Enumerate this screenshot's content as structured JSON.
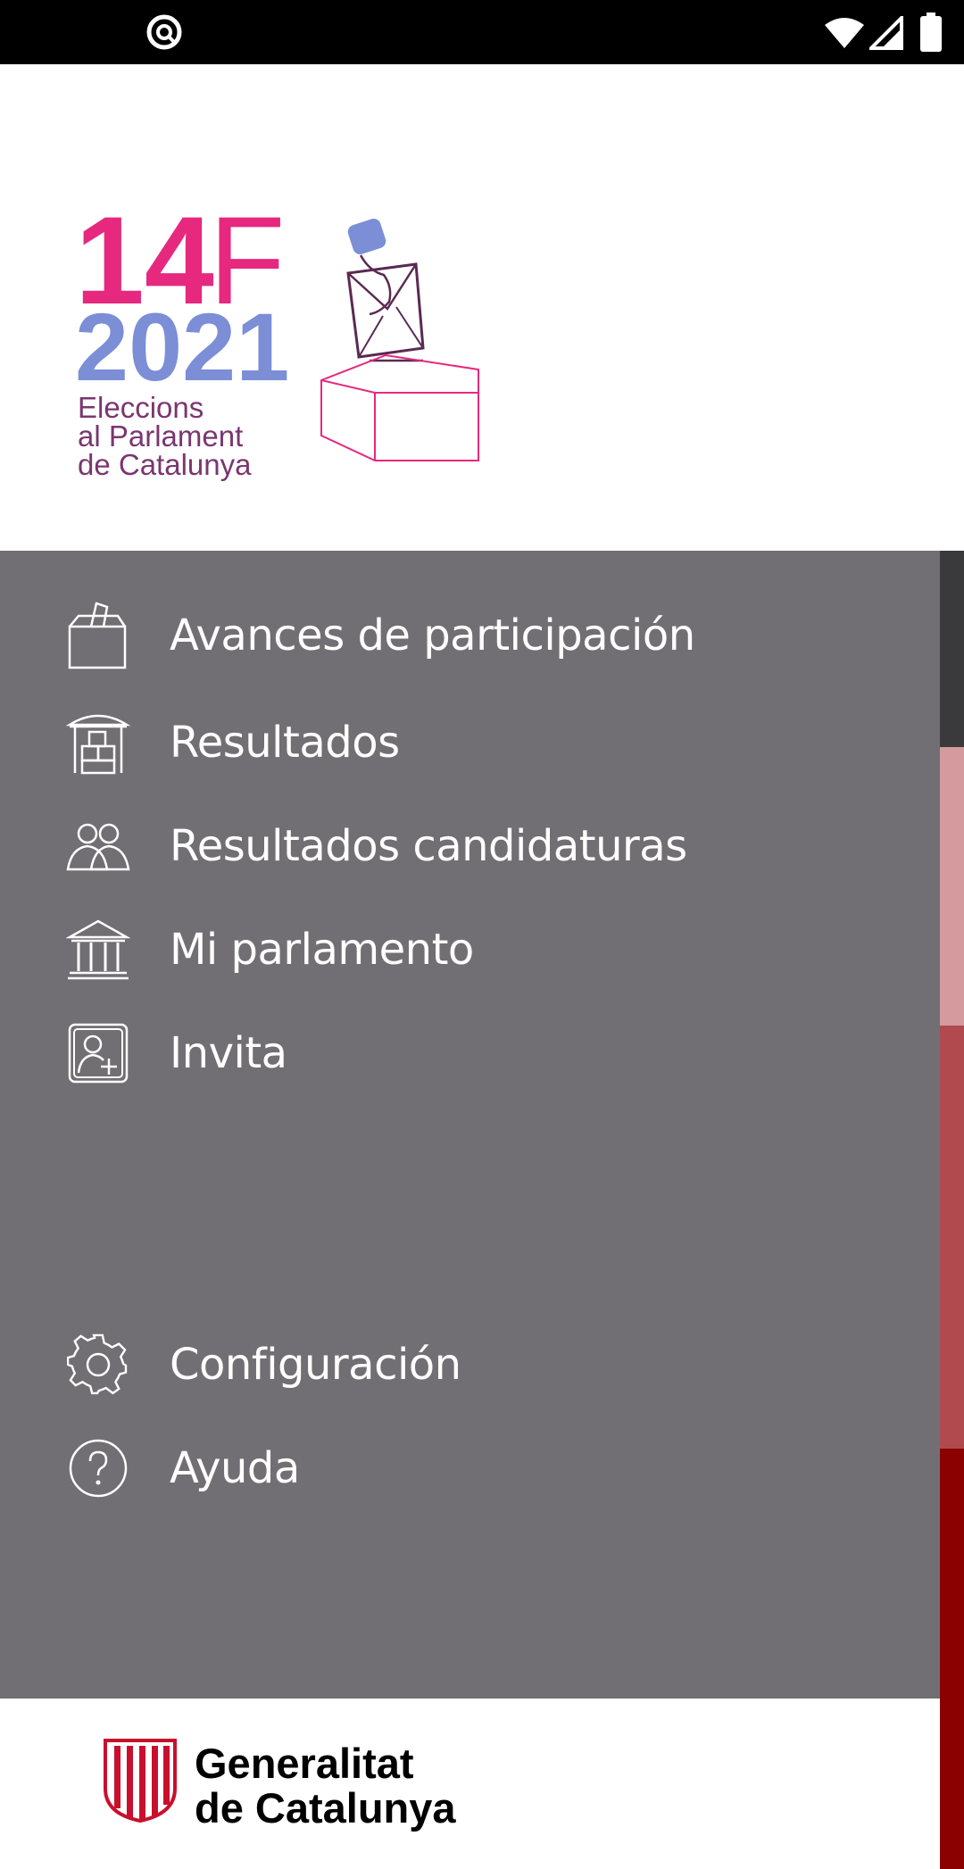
{
  "status_bar": {
    "left_icon": "do-not-disturb-icon",
    "right_icons": [
      "wifi-icon",
      "signal-icon",
      "battery-icon"
    ]
  },
  "logo": {
    "number": "14",
    "letter": "F",
    "year": "2021",
    "line1": "Eleccions",
    "line2": "al Parlament",
    "line3": "de Catalunya",
    "colors": {
      "pink": "#e6287e",
      "blue": "#7b8ed6",
      "purple": "#7a3670"
    }
  },
  "menu": {
    "items": [
      {
        "label": "Avances de participación",
        "icon": "ballot-box-icon"
      },
      {
        "label": "Resultados",
        "icon": "results-building-icon"
      },
      {
        "label": "Resultados candidaturas",
        "icon": "candidates-icon"
      },
      {
        "label": "Mi parlamento",
        "icon": "parliament-icon"
      },
      {
        "label": "Invita",
        "icon": "invite-user-icon"
      }
    ],
    "secondary": [
      {
        "label": "Configuración",
        "icon": "gear-icon"
      },
      {
        "label": "Ayuda",
        "icon": "help-icon"
      }
    ],
    "background": "#716f73"
  },
  "side_strip_colors": [
    "#3a3a3c",
    "#d49a9e",
    "#b04a4f",
    "#8b0000"
  ],
  "footer": {
    "brand_line1": "Generalitat",
    "brand_line2": "de Catalunya",
    "emblem": "senyera-emblem"
  }
}
